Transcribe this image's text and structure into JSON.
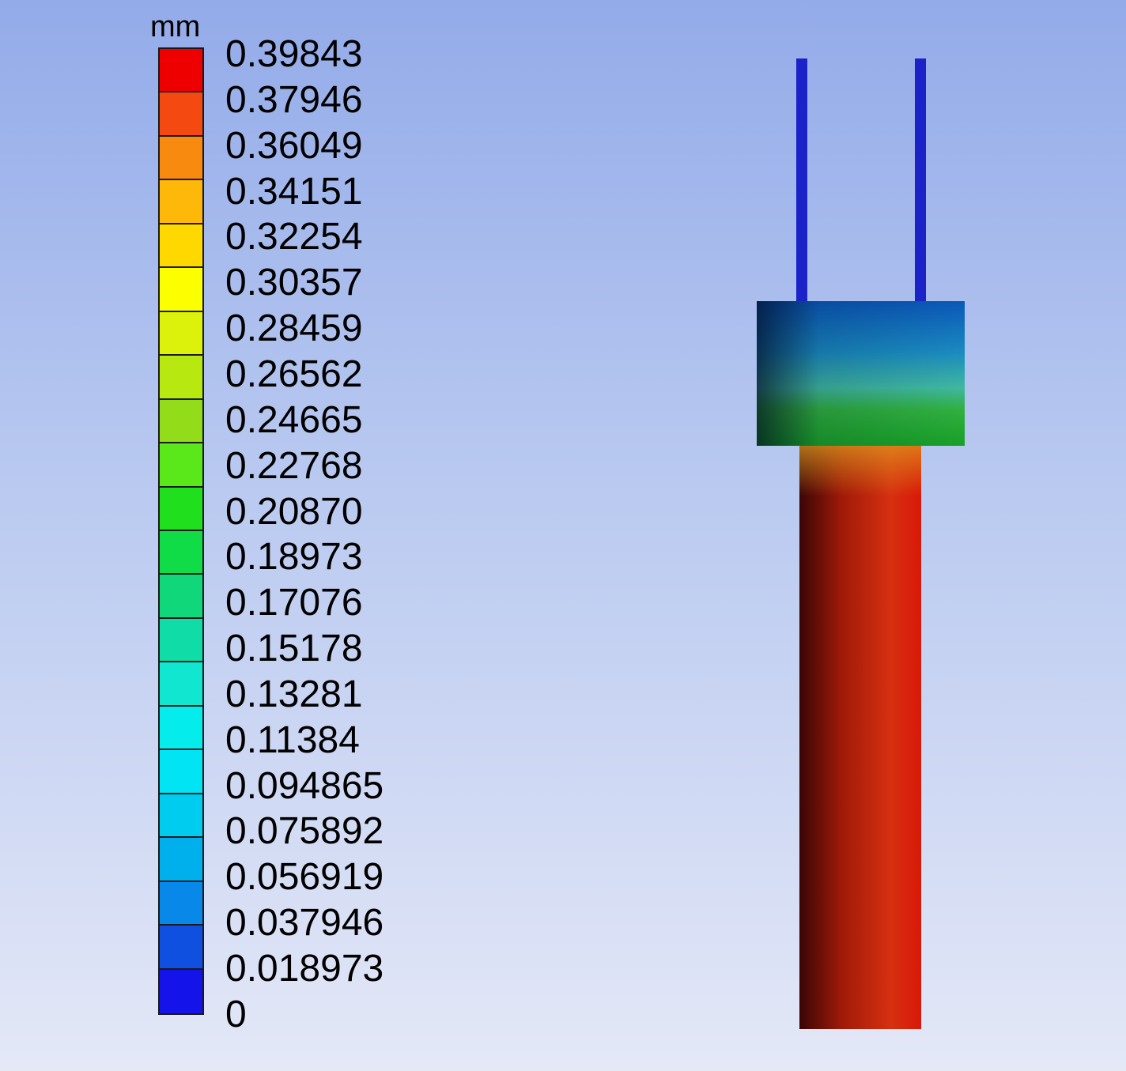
{
  "legend": {
    "unit": "mm",
    "values": [
      "0.39843",
      "0.37946",
      "0.36049",
      "0.34151",
      "0.32254",
      "0.30357",
      "0.28459",
      "0.26562",
      "0.24665",
      "0.22768",
      "0.20870",
      "0.18973",
      "0.17076",
      "0.15178",
      "0.13281",
      "0.11384",
      "0.094865",
      "0.075892",
      "0.056919",
      "0.037946",
      "0.018973",
      "0"
    ],
    "band_colors": [
      "#ee0000",
      "#f44a12",
      "#f98a10",
      "#fdb80a",
      "#ffd800",
      "#fbff00",
      "#ddf20a",
      "#b7e810",
      "#93dc1a",
      "#5be81a",
      "#20df1c",
      "#10dc48",
      "#10d87a",
      "#10dca8",
      "#10e6d0",
      "#04ecec",
      "#00e4f4",
      "#00ccf0",
      "#00b0ec",
      "#0888e8",
      "#1050e0",
      "#1414ea"
    ]
  },
  "colors": {
    "rods": "#1a1ad0",
    "collar_top": "#0a3a8a",
    "collar_bottom": "#20b040",
    "shaft_light": "#e03010",
    "shaft_dark": "#4a0808"
  }
}
